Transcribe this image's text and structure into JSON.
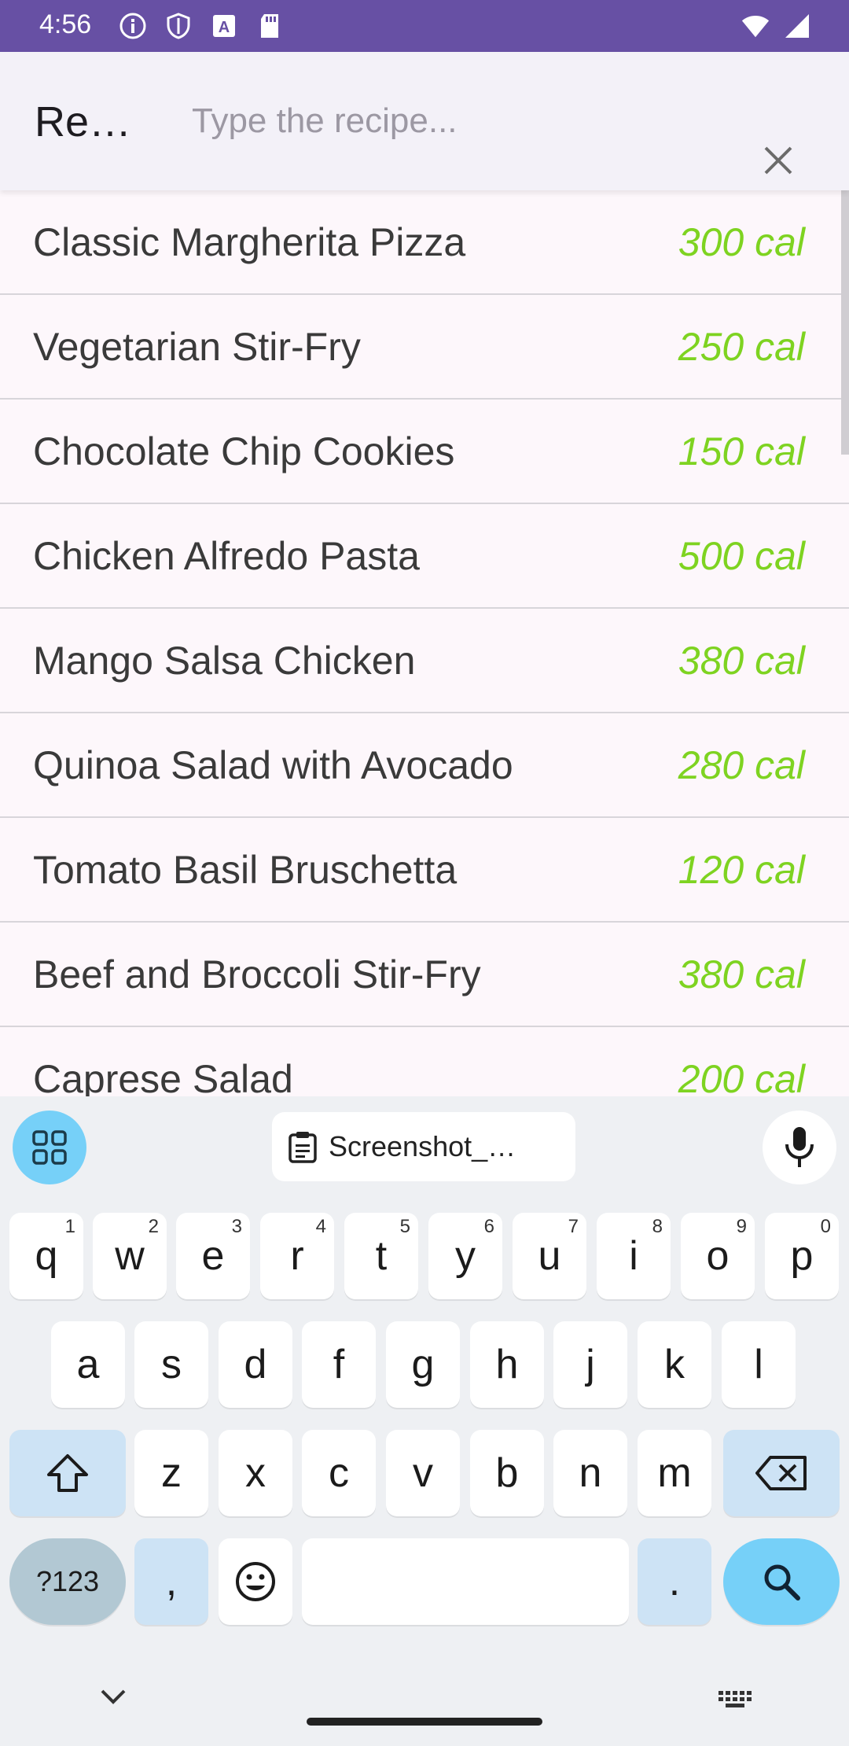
{
  "status_bar": {
    "time": "4:56"
  },
  "app_bar": {
    "title": "Re…",
    "search_placeholder": "Type the recipe...",
    "search_value": ""
  },
  "recipes": [
    {
      "name": "Classic Margherita Pizza",
      "calories": "300 cal"
    },
    {
      "name": "Vegetarian Stir-Fry",
      "calories": "250 cal"
    },
    {
      "name": "Chocolate Chip Cookies",
      "calories": "150 cal"
    },
    {
      "name": "Chicken Alfredo Pasta",
      "calories": "500 cal"
    },
    {
      "name": "Mango Salsa Chicken",
      "calories": "380 cal"
    },
    {
      "name": "Quinoa Salad with Avocado",
      "calories": "280 cal"
    },
    {
      "name": "Tomato Basil Bruschetta",
      "calories": "120 cal"
    },
    {
      "name": "Beef and Broccoli Stir-Fry",
      "calories": "380 cal"
    },
    {
      "name": "Caprese Salad",
      "calories": "200 cal"
    }
  ],
  "keyboard": {
    "clipboard_chip": "Screenshot_…",
    "row1": [
      {
        "key": "q",
        "hint": "1"
      },
      {
        "key": "w",
        "hint": "2"
      },
      {
        "key": "e",
        "hint": "3"
      },
      {
        "key": "r",
        "hint": "4"
      },
      {
        "key": "t",
        "hint": "5"
      },
      {
        "key": "y",
        "hint": "6"
      },
      {
        "key": "u",
        "hint": "7"
      },
      {
        "key": "i",
        "hint": "8"
      },
      {
        "key": "o",
        "hint": "9"
      },
      {
        "key": "p",
        "hint": "0"
      }
    ],
    "row2": [
      "a",
      "s",
      "d",
      "f",
      "g",
      "h",
      "j",
      "k",
      "l"
    ],
    "row3": [
      "z",
      "x",
      "c",
      "v",
      "b",
      "n",
      "m"
    ],
    "symbols_label": "?123",
    "comma": ",",
    "period": "."
  },
  "colors": {
    "status_bar": "#6750a4",
    "calorie_text": "#7ed321",
    "accent_key": "#76d0f8"
  }
}
